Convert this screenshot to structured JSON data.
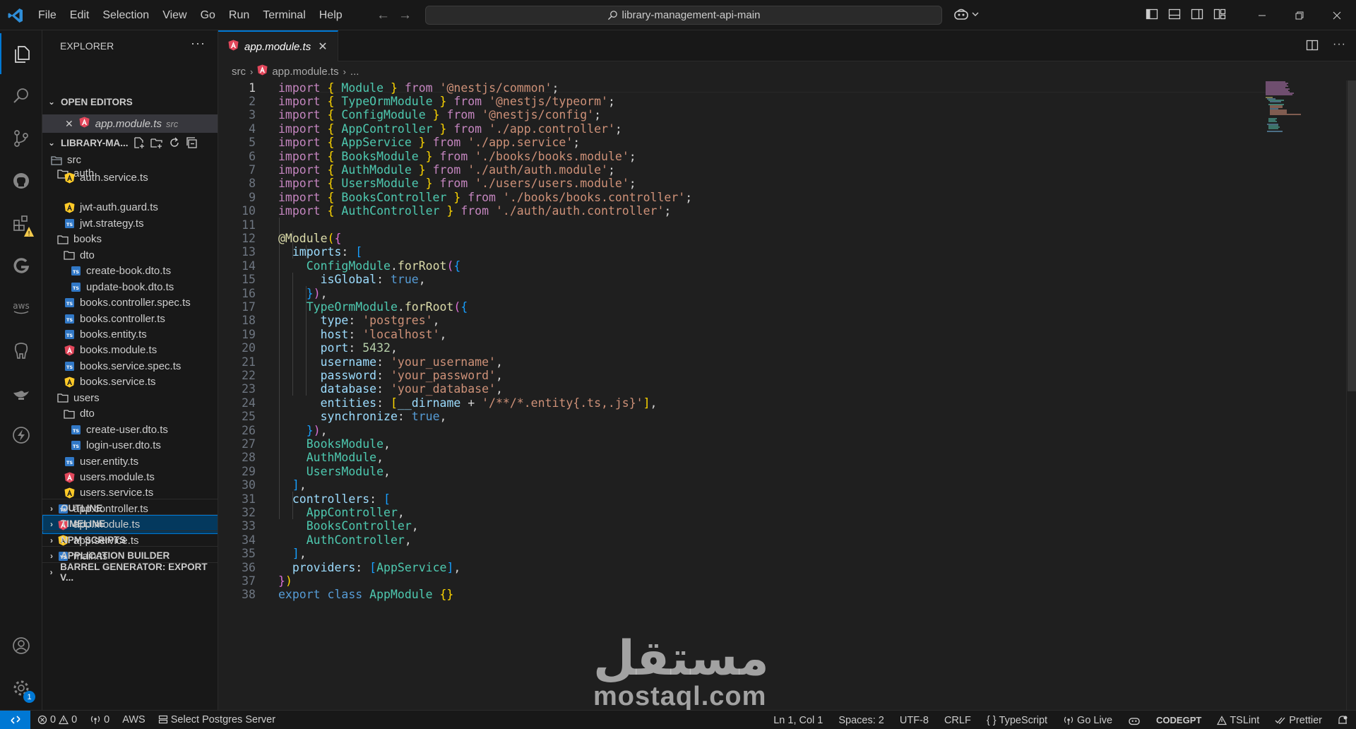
{
  "menu": [
    "File",
    "Edit",
    "Selection",
    "View",
    "Go",
    "Run",
    "Terminal",
    "Help"
  ],
  "search": {
    "text": "library-management-api-main"
  },
  "explorer": {
    "title": "EXPLORER",
    "more": "···",
    "open_editors_label": "OPEN EDITORS",
    "open_editor": {
      "name": "app.module.ts",
      "desc": "src"
    },
    "project_label": "LIBRARY-MA...",
    "tree": [
      {
        "label": "src",
        "depth": 0,
        "type": "folder-open"
      },
      {
        "label": "auth",
        "depth": 1,
        "type": "folder"
      },
      {
        "label": "auth.service.ts",
        "depth": 2,
        "type": "service"
      },
      {
        "label": "jwt-auth.guard.ts",
        "depth": 2,
        "type": "service"
      },
      {
        "label": "jwt.strategy.ts",
        "depth": 2,
        "type": "ts"
      },
      {
        "label": "books",
        "depth": 1,
        "type": "folder"
      },
      {
        "label": "dto",
        "depth": 2,
        "type": "folder"
      },
      {
        "label": "create-book.dto.ts",
        "depth": 3,
        "type": "ts"
      },
      {
        "label": "update-book.dto.ts",
        "depth": 3,
        "type": "ts"
      },
      {
        "label": "books.controller.spec.ts",
        "depth": 2,
        "type": "ts"
      },
      {
        "label": "books.controller.ts",
        "depth": 2,
        "type": "ts"
      },
      {
        "label": "books.entity.ts",
        "depth": 2,
        "type": "ts"
      },
      {
        "label": "books.module.ts",
        "depth": 2,
        "type": "angular"
      },
      {
        "label": "books.service.spec.ts",
        "depth": 2,
        "type": "ts"
      },
      {
        "label": "books.service.ts",
        "depth": 2,
        "type": "service"
      },
      {
        "label": "users",
        "depth": 1,
        "type": "folder"
      },
      {
        "label": "dto",
        "depth": 2,
        "type": "folder"
      },
      {
        "label": "create-user.dto.ts",
        "depth": 3,
        "type": "ts"
      },
      {
        "label": "login-user.dto.ts",
        "depth": 3,
        "type": "ts"
      },
      {
        "label": "user.entity.ts",
        "depth": 2,
        "type": "ts"
      },
      {
        "label": "users.module.ts",
        "depth": 2,
        "type": "angular"
      },
      {
        "label": "users.service.ts",
        "depth": 2,
        "type": "service"
      },
      {
        "label": "app.controller.ts",
        "depth": 1,
        "type": "ts"
      },
      {
        "label": "app.module.ts",
        "depth": 1,
        "type": "angular",
        "selected": true
      },
      {
        "label": "app.service.ts",
        "depth": 1,
        "type": "service"
      },
      {
        "label": "main.ts",
        "depth": 1,
        "type": "ts"
      }
    ],
    "sections": [
      "OUTLINE",
      "TIMELINE",
      "NPM SCRIPTS",
      "APPLICATION BUILDER",
      "BARREL GENERATOR: EXPORT V..."
    ]
  },
  "tab": {
    "name": "app.module.ts"
  },
  "breadcrumb": {
    "folder": "src",
    "file": "app.module.ts",
    "more": "..."
  },
  "code_lines": [
    [
      [
        "k",
        "import"
      ],
      [
        "p",
        " "
      ],
      [
        "y",
        "{"
      ],
      [
        "p",
        " "
      ],
      [
        "t",
        "Module"
      ],
      [
        "p",
        " "
      ],
      [
        "y",
        "}"
      ],
      [
        "p",
        " "
      ],
      [
        "k",
        "from"
      ],
      [
        "p",
        " "
      ],
      [
        "s",
        "'@nestjs/common'"
      ],
      [
        "p",
        ";"
      ]
    ],
    [
      [
        "k",
        "import"
      ],
      [
        "p",
        " "
      ],
      [
        "y",
        "{"
      ],
      [
        "p",
        " "
      ],
      [
        "t",
        "TypeOrmModule"
      ],
      [
        "p",
        " "
      ],
      [
        "y",
        "}"
      ],
      [
        "p",
        " "
      ],
      [
        "k",
        "from"
      ],
      [
        "p",
        " "
      ],
      [
        "s",
        "'@nestjs/typeorm'"
      ],
      [
        "p",
        ";"
      ]
    ],
    [
      [
        "k",
        "import"
      ],
      [
        "p",
        " "
      ],
      [
        "y",
        "{"
      ],
      [
        "p",
        " "
      ],
      [
        "t",
        "ConfigModule"
      ],
      [
        "p",
        " "
      ],
      [
        "y",
        "}"
      ],
      [
        "p",
        " "
      ],
      [
        "k",
        "from"
      ],
      [
        "p",
        " "
      ],
      [
        "s",
        "'@nestjs/config'"
      ],
      [
        "p",
        ";"
      ]
    ],
    [
      [
        "k",
        "import"
      ],
      [
        "p",
        " "
      ],
      [
        "y",
        "{"
      ],
      [
        "p",
        " "
      ],
      [
        "t",
        "AppController"
      ],
      [
        "p",
        " "
      ],
      [
        "y",
        "}"
      ],
      [
        "p",
        " "
      ],
      [
        "k",
        "from"
      ],
      [
        "p",
        " "
      ],
      [
        "s",
        "'./app.controller'"
      ],
      [
        "p",
        ";"
      ]
    ],
    [
      [
        "k",
        "import"
      ],
      [
        "p",
        " "
      ],
      [
        "y",
        "{"
      ],
      [
        "p",
        " "
      ],
      [
        "t",
        "AppService"
      ],
      [
        "p",
        " "
      ],
      [
        "y",
        "}"
      ],
      [
        "p",
        " "
      ],
      [
        "k",
        "from"
      ],
      [
        "p",
        " "
      ],
      [
        "s",
        "'./app.service'"
      ],
      [
        "p",
        ";"
      ]
    ],
    [
      [
        "k",
        "import"
      ],
      [
        "p",
        " "
      ],
      [
        "y",
        "{"
      ],
      [
        "p",
        " "
      ],
      [
        "t",
        "BooksModule"
      ],
      [
        "p",
        " "
      ],
      [
        "y",
        "}"
      ],
      [
        "p",
        " "
      ],
      [
        "k",
        "from"
      ],
      [
        "p",
        " "
      ],
      [
        "s",
        "'./books/books.module'"
      ],
      [
        "p",
        ";"
      ]
    ],
    [
      [
        "k",
        "import"
      ],
      [
        "p",
        " "
      ],
      [
        "y",
        "{"
      ],
      [
        "p",
        " "
      ],
      [
        "t",
        "AuthModule"
      ],
      [
        "p",
        " "
      ],
      [
        "y",
        "}"
      ],
      [
        "p",
        " "
      ],
      [
        "k",
        "from"
      ],
      [
        "p",
        " "
      ],
      [
        "s",
        "'./auth/auth.module'"
      ],
      [
        "p",
        ";"
      ]
    ],
    [
      [
        "k",
        "import"
      ],
      [
        "p",
        " "
      ],
      [
        "y",
        "{"
      ],
      [
        "p",
        " "
      ],
      [
        "t",
        "UsersModule"
      ],
      [
        "p",
        " "
      ],
      [
        "y",
        "}"
      ],
      [
        "p",
        " "
      ],
      [
        "k",
        "from"
      ],
      [
        "p",
        " "
      ],
      [
        "s",
        "'./users/users.module'"
      ],
      [
        "p",
        ";"
      ]
    ],
    [
      [
        "k",
        "import"
      ],
      [
        "p",
        " "
      ],
      [
        "y",
        "{"
      ],
      [
        "p",
        " "
      ],
      [
        "t",
        "BooksController"
      ],
      [
        "p",
        " "
      ],
      [
        "y",
        "}"
      ],
      [
        "p",
        " "
      ],
      [
        "k",
        "from"
      ],
      [
        "p",
        " "
      ],
      [
        "s",
        "'./books/books.controller'"
      ],
      [
        "p",
        ";"
      ]
    ],
    [
      [
        "k",
        "import"
      ],
      [
        "p",
        " "
      ],
      [
        "y",
        "{"
      ],
      [
        "p",
        " "
      ],
      [
        "t",
        "AuthController"
      ],
      [
        "p",
        " "
      ],
      [
        "y",
        "}"
      ],
      [
        "p",
        " "
      ],
      [
        "k",
        "from"
      ],
      [
        "p",
        " "
      ],
      [
        "s",
        "'./auth/auth.controller'"
      ],
      [
        "p",
        ";"
      ]
    ],
    [],
    [
      [
        "f",
        "@Module"
      ],
      [
        "y",
        "("
      ],
      [
        "m",
        "{"
      ]
    ],
    [
      [
        "p",
        "  "
      ],
      [
        "v",
        "imports"
      ],
      [
        "p",
        ": "
      ],
      [
        "c2",
        "["
      ]
    ],
    [
      [
        "p",
        "    "
      ],
      [
        "t",
        "ConfigModule"
      ],
      [
        "p",
        "."
      ],
      [
        "f",
        "forRoot"
      ],
      [
        "m",
        "("
      ],
      [
        "c2",
        "{"
      ]
    ],
    [
      [
        "p",
        "      "
      ],
      [
        "v",
        "isGlobal"
      ],
      [
        "p",
        ": "
      ],
      [
        "b",
        "true"
      ],
      [
        "p",
        ","
      ]
    ],
    [
      [
        "p",
        "    "
      ],
      [
        "c2",
        "}"
      ],
      [
        "m",
        ")"
      ],
      [
        "p",
        ","
      ]
    ],
    [
      [
        "p",
        "    "
      ],
      [
        "t",
        "TypeOrmModule"
      ],
      [
        "p",
        "."
      ],
      [
        "f",
        "forRoot"
      ],
      [
        "m",
        "("
      ],
      [
        "c2",
        "{"
      ]
    ],
    [
      [
        "p",
        "      "
      ],
      [
        "v",
        "type"
      ],
      [
        "p",
        ": "
      ],
      [
        "s",
        "'postgres'"
      ],
      [
        "p",
        ","
      ]
    ],
    [
      [
        "p",
        "      "
      ],
      [
        "v",
        "host"
      ],
      [
        "p",
        ": "
      ],
      [
        "s",
        "'localhost'"
      ],
      [
        "p",
        ","
      ]
    ],
    [
      [
        "p",
        "      "
      ],
      [
        "v",
        "port"
      ],
      [
        "p",
        ": "
      ],
      [
        "n",
        "5432"
      ],
      [
        "p",
        ","
      ]
    ],
    [
      [
        "p",
        "      "
      ],
      [
        "v",
        "username"
      ],
      [
        "p",
        ": "
      ],
      [
        "s",
        "'your_username'"
      ],
      [
        "p",
        ","
      ]
    ],
    [
      [
        "p",
        "      "
      ],
      [
        "v",
        "password"
      ],
      [
        "p",
        ": "
      ],
      [
        "s",
        "'your_password'"
      ],
      [
        "p",
        ","
      ]
    ],
    [
      [
        "p",
        "      "
      ],
      [
        "v",
        "database"
      ],
      [
        "p",
        ": "
      ],
      [
        "s",
        "'your_database'"
      ],
      [
        "p",
        ","
      ]
    ],
    [
      [
        "p",
        "      "
      ],
      [
        "v",
        "entities"
      ],
      [
        "p",
        ": "
      ],
      [
        "y",
        "["
      ],
      [
        "v",
        "__dirname"
      ],
      [
        "p",
        " + "
      ],
      [
        "s",
        "'/**/*.entity{.ts,.js}'"
      ],
      [
        "y",
        "]"
      ],
      [
        "p",
        ","
      ]
    ],
    [
      [
        "p",
        "      "
      ],
      [
        "v",
        "synchronize"
      ],
      [
        "p",
        ": "
      ],
      [
        "b",
        "true"
      ],
      [
        "p",
        ","
      ]
    ],
    [
      [
        "p",
        "    "
      ],
      [
        "c2",
        "}"
      ],
      [
        "m",
        ")"
      ],
      [
        "p",
        ","
      ]
    ],
    [
      [
        "p",
        "    "
      ],
      [
        "t",
        "BooksModule"
      ],
      [
        "p",
        ","
      ]
    ],
    [
      [
        "p",
        "    "
      ],
      [
        "t",
        "AuthModule"
      ],
      [
        "p",
        ","
      ]
    ],
    [
      [
        "p",
        "    "
      ],
      [
        "t",
        "UsersModule"
      ],
      [
        "p",
        ","
      ]
    ],
    [
      [
        "p",
        "  "
      ],
      [
        "c2",
        "]"
      ],
      [
        "p",
        ","
      ]
    ],
    [
      [
        "p",
        "  "
      ],
      [
        "v",
        "controllers"
      ],
      [
        "p",
        ": "
      ],
      [
        "c2",
        "["
      ]
    ],
    [
      [
        "p",
        "    "
      ],
      [
        "t",
        "AppController"
      ],
      [
        "p",
        ","
      ]
    ],
    [
      [
        "p",
        "    "
      ],
      [
        "t",
        "BooksController"
      ],
      [
        "p",
        ","
      ]
    ],
    [
      [
        "p",
        "    "
      ],
      [
        "t",
        "AuthController"
      ],
      [
        "p",
        ","
      ]
    ],
    [
      [
        "p",
        "  "
      ],
      [
        "c2",
        "]"
      ],
      [
        "p",
        ","
      ]
    ],
    [
      [
        "p",
        "  "
      ],
      [
        "v",
        "providers"
      ],
      [
        "p",
        ": "
      ],
      [
        "c2",
        "["
      ],
      [
        "t",
        "AppService"
      ],
      [
        "c2",
        "]"
      ],
      [
        "p",
        ","
      ]
    ],
    [
      [
        "m",
        "}"
      ],
      [
        "y",
        ")"
      ]
    ],
    [
      [
        "b",
        "export"
      ],
      [
        "p",
        " "
      ],
      [
        "b",
        "class"
      ],
      [
        "p",
        " "
      ],
      [
        "t",
        "AppModule"
      ],
      [
        "p",
        " "
      ],
      [
        "y",
        "{}"
      ]
    ]
  ],
  "watermark": {
    "arabic": "مستقل",
    "latin": "mostaql.com"
  },
  "status": {
    "errors": "0",
    "warnings": "0",
    "ports": "0",
    "aws": "AWS",
    "postgres": "Select Postgres Server",
    "position": "Ln 1, Col 1",
    "spaces": "Spaces: 2",
    "encoding": "UTF-8",
    "eol": "CRLF",
    "language": "TypeScript",
    "golive": "Go Live",
    "codegpt": "CODEGPT",
    "tslint": "TSLint",
    "prettier": "Prettier"
  },
  "colors": {
    "accent": "#0078d4",
    "angular": "#e2475b",
    "ts": "#3178c6",
    "service": "#ffca28"
  }
}
